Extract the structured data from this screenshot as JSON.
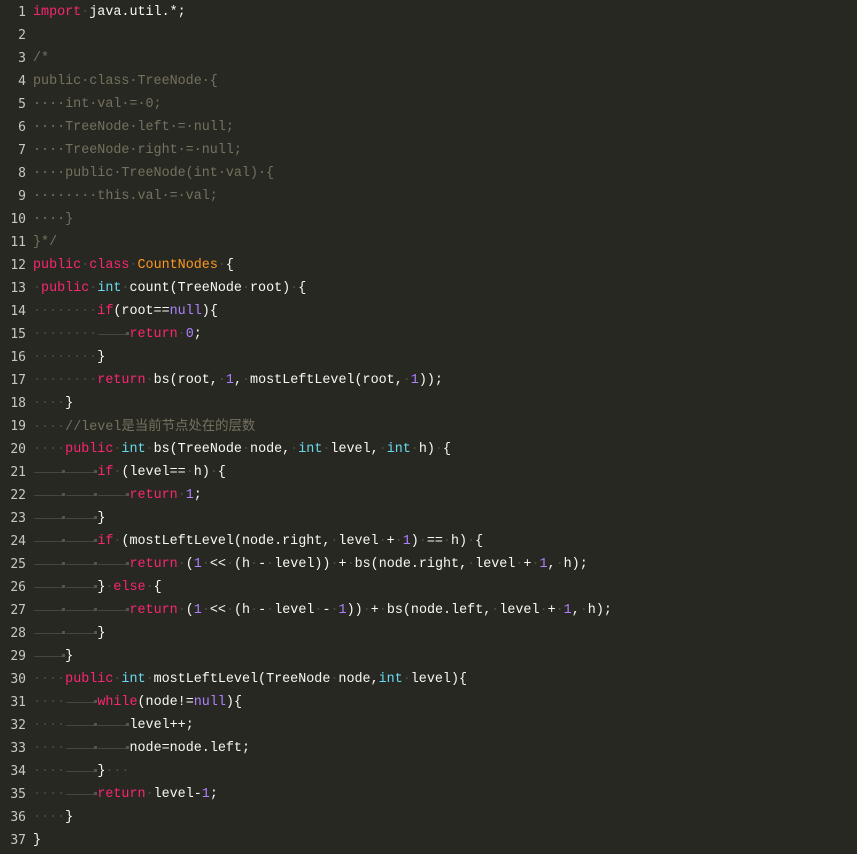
{
  "editor": {
    "theme": {
      "background": "#272822",
      "keyword": "#f92672",
      "type": "#66d9ef",
      "number": "#ae81ff",
      "class_name": "#fd971f",
      "comment": "#75715e",
      "plain": "#f8f8f2"
    },
    "lines": [
      {
        "n": "1",
        "tokens": [
          [
            "kw",
            "import"
          ],
          [
            "ws",
            "·"
          ],
          [
            "p",
            "java.util.*;"
          ]
        ]
      },
      {
        "n": "2",
        "tokens": []
      },
      {
        "n": "3",
        "tokens": [
          [
            "cm",
            "/*"
          ]
        ]
      },
      {
        "n": "4",
        "tokens": [
          [
            "cm",
            "public·class·TreeNode·{"
          ]
        ]
      },
      {
        "n": "5",
        "tokens": [
          [
            "cm",
            "····int·val·=·0;"
          ]
        ]
      },
      {
        "n": "6",
        "tokens": [
          [
            "cm",
            "····TreeNode·left·=·null;"
          ]
        ]
      },
      {
        "n": "7",
        "tokens": [
          [
            "cm",
            "····TreeNode·right·=·null;"
          ]
        ]
      },
      {
        "n": "8",
        "tokens": [
          [
            "cm",
            "····public·TreeNode(int·val)·{"
          ]
        ]
      },
      {
        "n": "9",
        "tokens": [
          [
            "cm",
            "········this.val·=·val;"
          ]
        ]
      },
      {
        "n": "10",
        "tokens": [
          [
            "cm",
            "····}"
          ]
        ]
      },
      {
        "n": "11",
        "tokens": [
          [
            "cm",
            "}*/"
          ]
        ]
      },
      {
        "n": "12",
        "tokens": [
          [
            "kw",
            "public"
          ],
          [
            "ws",
            "·"
          ],
          [
            "kw",
            "class"
          ],
          [
            "ws",
            "·"
          ],
          [
            "cls",
            "CountNodes"
          ],
          [
            "ws",
            "·"
          ],
          [
            "p",
            "{"
          ]
        ]
      },
      {
        "n": "13",
        "tokens": [
          [
            "ws",
            "·"
          ],
          [
            "kw",
            "public"
          ],
          [
            "ws",
            "·"
          ],
          [
            "ty",
            "int"
          ],
          [
            "ws",
            "·"
          ],
          [
            "p",
            "count(TreeNode"
          ],
          [
            "ws",
            "·"
          ],
          [
            "p",
            "root)"
          ],
          [
            "ws",
            "·"
          ],
          [
            "p",
            "{"
          ]
        ]
      },
      {
        "n": "14",
        "tokens": [
          [
            "ws",
            "········"
          ],
          [
            "kw",
            "if"
          ],
          [
            "p",
            "(root=="
          ],
          [
            "num",
            "null"
          ],
          [
            "p",
            "){"
          ]
        ]
      },
      {
        "n": "15",
        "tokens": [
          [
            "ws",
            "········"
          ],
          [
            "tab",
            "    "
          ],
          [
            "kw",
            "return"
          ],
          [
            "ws",
            "·"
          ],
          [
            "num",
            "0"
          ],
          [
            "p",
            ";"
          ]
        ]
      },
      {
        "n": "16",
        "tokens": [
          [
            "ws",
            "········"
          ],
          [
            "p",
            "}"
          ]
        ]
      },
      {
        "n": "17",
        "tokens": [
          [
            "ws",
            "········"
          ],
          [
            "kw",
            "return"
          ],
          [
            "ws",
            "·"
          ],
          [
            "p",
            "bs(root,"
          ],
          [
            "ws",
            "·"
          ],
          [
            "num",
            "1"
          ],
          [
            "p",
            ","
          ],
          [
            "ws",
            "·"
          ],
          [
            "p",
            "mostLeftLevel(root,"
          ],
          [
            "ws",
            "·"
          ],
          [
            "num",
            "1"
          ],
          [
            "p",
            "));"
          ]
        ]
      },
      {
        "n": "18",
        "tokens": [
          [
            "ws",
            "····"
          ],
          [
            "p",
            "}"
          ]
        ]
      },
      {
        "n": "19",
        "tokens": [
          [
            "ws",
            "····"
          ],
          [
            "cm",
            "//level"
          ],
          [
            "cmcjk",
            "是当前节点处在的层数"
          ]
        ]
      },
      {
        "n": "20",
        "tokens": [
          [
            "ws",
            "····"
          ],
          [
            "kw",
            "public"
          ],
          [
            "ws",
            "·"
          ],
          [
            "ty",
            "int"
          ],
          [
            "ws",
            "·"
          ],
          [
            "p",
            "bs(TreeNode"
          ],
          [
            "ws",
            "·"
          ],
          [
            "p",
            "node,"
          ],
          [
            "ws",
            "·"
          ],
          [
            "ty",
            "int"
          ],
          [
            "ws",
            "·"
          ],
          [
            "p",
            "level,"
          ],
          [
            "ws",
            "·"
          ],
          [
            "ty",
            "int"
          ],
          [
            "ws",
            "·"
          ],
          [
            "p",
            "h)"
          ],
          [
            "ws",
            "·"
          ],
          [
            "p",
            "{"
          ]
        ]
      },
      {
        "n": "21",
        "tokens": [
          [
            "tab",
            "    "
          ],
          [
            "tab",
            "    "
          ],
          [
            "kw",
            "if"
          ],
          [
            "ws",
            "·"
          ],
          [
            "p",
            "(level=="
          ],
          [
            "ws",
            "·"
          ],
          [
            "p",
            "h)"
          ],
          [
            "ws",
            "·"
          ],
          [
            "p",
            "{"
          ]
        ]
      },
      {
        "n": "22",
        "tokens": [
          [
            "tab",
            "    "
          ],
          [
            "tab",
            "    "
          ],
          [
            "tab",
            "    "
          ],
          [
            "kw",
            "return"
          ],
          [
            "ws",
            "·"
          ],
          [
            "num",
            "1"
          ],
          [
            "p",
            ";"
          ]
        ]
      },
      {
        "n": "23",
        "tokens": [
          [
            "tab",
            "    "
          ],
          [
            "tab",
            "    "
          ],
          [
            "p",
            "}"
          ]
        ]
      },
      {
        "n": "24",
        "tokens": [
          [
            "tab",
            "    "
          ],
          [
            "tab",
            "    "
          ],
          [
            "kw",
            "if"
          ],
          [
            "ws",
            "·"
          ],
          [
            "p",
            "(mostLeftLevel(node.right,"
          ],
          [
            "ws",
            "·"
          ],
          [
            "p",
            "level"
          ],
          [
            "ws",
            "·"
          ],
          [
            "p",
            "+"
          ],
          [
            "ws",
            "·"
          ],
          [
            "num",
            "1"
          ],
          [
            "p",
            ")"
          ],
          [
            "ws",
            "·"
          ],
          [
            "p",
            "=="
          ],
          [
            "ws",
            "·"
          ],
          [
            "p",
            "h)"
          ],
          [
            "ws",
            "·"
          ],
          [
            "p",
            "{"
          ]
        ]
      },
      {
        "n": "25",
        "tokens": [
          [
            "tab",
            "    "
          ],
          [
            "tab",
            "    "
          ],
          [
            "tab",
            "    "
          ],
          [
            "kw",
            "return"
          ],
          [
            "ws",
            "·"
          ],
          [
            "p",
            "("
          ],
          [
            "num",
            "1"
          ],
          [
            "ws",
            "·"
          ],
          [
            "p",
            "<<"
          ],
          [
            "ws",
            "·"
          ],
          [
            "p",
            "(h"
          ],
          [
            "ws",
            "·"
          ],
          [
            "p",
            "-"
          ],
          [
            "ws",
            "·"
          ],
          [
            "p",
            "level))"
          ],
          [
            "ws",
            "·"
          ],
          [
            "p",
            "+"
          ],
          [
            "ws",
            "·"
          ],
          [
            "p",
            "bs(node.right,"
          ],
          [
            "ws",
            "·"
          ],
          [
            "p",
            "level"
          ],
          [
            "ws",
            "·"
          ],
          [
            "p",
            "+"
          ],
          [
            "ws",
            "·"
          ],
          [
            "num",
            "1"
          ],
          [
            "p",
            ","
          ],
          [
            "ws",
            "·"
          ],
          [
            "p",
            "h);"
          ]
        ]
      },
      {
        "n": "26",
        "tokens": [
          [
            "tab",
            "    "
          ],
          [
            "tab",
            "    "
          ],
          [
            "p",
            "}"
          ],
          [
            "ws",
            "·"
          ],
          [
            "kw",
            "else"
          ],
          [
            "ws",
            "·"
          ],
          [
            "p",
            "{"
          ]
        ]
      },
      {
        "n": "27",
        "tokens": [
          [
            "tab",
            "    "
          ],
          [
            "tab",
            "    "
          ],
          [
            "tab",
            "    "
          ],
          [
            "kw",
            "return"
          ],
          [
            "ws",
            "·"
          ],
          [
            "p",
            "("
          ],
          [
            "num",
            "1"
          ],
          [
            "ws",
            "·"
          ],
          [
            "p",
            "<<"
          ],
          [
            "ws",
            "·"
          ],
          [
            "p",
            "(h"
          ],
          [
            "ws",
            "·"
          ],
          [
            "p",
            "-"
          ],
          [
            "ws",
            "·"
          ],
          [
            "p",
            "level"
          ],
          [
            "ws",
            "·"
          ],
          [
            "p",
            "-"
          ],
          [
            "ws",
            "·"
          ],
          [
            "num",
            "1"
          ],
          [
            "p",
            "))"
          ],
          [
            "ws",
            "·"
          ],
          [
            "p",
            "+"
          ],
          [
            "ws",
            "·"
          ],
          [
            "p",
            "bs(node.left,"
          ],
          [
            "ws",
            "·"
          ],
          [
            "p",
            "level"
          ],
          [
            "ws",
            "·"
          ],
          [
            "p",
            "+"
          ],
          [
            "ws",
            "·"
          ],
          [
            "num",
            "1"
          ],
          [
            "p",
            ","
          ],
          [
            "ws",
            "·"
          ],
          [
            "p",
            "h);"
          ]
        ]
      },
      {
        "n": "28",
        "tokens": [
          [
            "tab",
            "    "
          ],
          [
            "tab",
            "    "
          ],
          [
            "p",
            "}"
          ]
        ]
      },
      {
        "n": "29",
        "tokens": [
          [
            "tab",
            "    "
          ],
          [
            "p",
            "}"
          ]
        ]
      },
      {
        "n": "30",
        "tokens": [
          [
            "ws",
            "····"
          ],
          [
            "kw",
            "public"
          ],
          [
            "ws",
            "·"
          ],
          [
            "ty",
            "int"
          ],
          [
            "ws",
            "·"
          ],
          [
            "p",
            "mostLeftLevel(TreeNode"
          ],
          [
            "ws",
            "·"
          ],
          [
            "p",
            "node,"
          ],
          [
            "ty",
            "int"
          ],
          [
            "ws",
            "·"
          ],
          [
            "p",
            "level){"
          ]
        ]
      },
      {
        "n": "31",
        "tokens": [
          [
            "ws",
            "····"
          ],
          [
            "tab",
            "    "
          ],
          [
            "kw",
            "while"
          ],
          [
            "p",
            "(node!="
          ],
          [
            "num",
            "null"
          ],
          [
            "p",
            "){"
          ]
        ]
      },
      {
        "n": "32",
        "tokens": [
          [
            "ws",
            "····"
          ],
          [
            "tab",
            "    "
          ],
          [
            "tab",
            "    "
          ],
          [
            "p",
            "level++;"
          ]
        ]
      },
      {
        "n": "33",
        "tokens": [
          [
            "ws",
            "····"
          ],
          [
            "tab",
            "    "
          ],
          [
            "tab",
            "    "
          ],
          [
            "p",
            "node=node.left;"
          ]
        ]
      },
      {
        "n": "34",
        "tokens": [
          [
            "ws",
            "····"
          ],
          [
            "tab",
            "    "
          ],
          [
            "p",
            "}"
          ],
          [
            "ws",
            "···"
          ]
        ]
      },
      {
        "n": "35",
        "tokens": [
          [
            "ws",
            "····"
          ],
          [
            "tab",
            "    "
          ],
          [
            "kw",
            "return"
          ],
          [
            "ws",
            "·"
          ],
          [
            "p",
            "level-"
          ],
          [
            "num",
            "1"
          ],
          [
            "p",
            ";"
          ]
        ]
      },
      {
        "n": "36",
        "tokens": [
          [
            "ws",
            "····"
          ],
          [
            "p",
            "}"
          ]
        ]
      },
      {
        "n": "37",
        "tokens": [
          [
            "p",
            "}"
          ]
        ]
      }
    ]
  }
}
